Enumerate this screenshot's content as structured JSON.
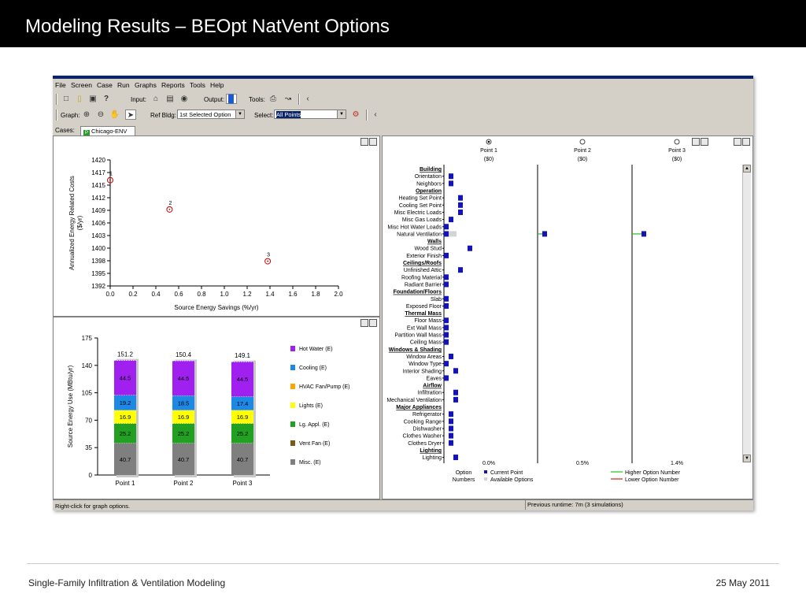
{
  "slide": {
    "title": "Modeling Results – BEOpt NatVent Options",
    "footer_left": "Single-Family Infiltration & Ventilation Modeling",
    "footer_right": "25 May 2011"
  },
  "menu": [
    "File",
    "Screen",
    "Case",
    "Run",
    "Graphs",
    "Reports",
    "Tools",
    "Help"
  ],
  "toolbar1": {
    "input_label": "Input:",
    "output_label": "Output:",
    "tools_label": "Tools:"
  },
  "toolbar2": {
    "graph_label": "Graph:",
    "ref_bldg_label": "Ref Bldg:",
    "ref_bldg_value": "1st Selected Option",
    "select_label": "Select:",
    "select_value": "All Points"
  },
  "cases": {
    "label": "Cases:",
    "tab": "Chicago-ENV"
  },
  "status": {
    "left": "Right-click for graph options.",
    "right": "Previous runtime: 7m (3 simulations)"
  },
  "colors": {
    "accent": "#0a246a",
    "point_marker": "#c00000",
    "option_bar": "#1414b4",
    "available": "#d3d3d3",
    "higher": "#22c022",
    "lower": "#e02020"
  },
  "chart_data": [
    {
      "type": "scatter",
      "xlabel": "Source Energy Savings (%/yr)",
      "ylabel": "Annualized Energy Related Costs ($/yr)",
      "xlim": [
        0,
        2.0
      ],
      "ylim": [
        1392,
        1420
      ],
      "x_ticks": [
        "0.0",
        "0.2",
        "0.4",
        "0.6",
        "0.8",
        "1.0",
        "1.2",
        "1.4",
        "1.6",
        "1.8",
        "2.0"
      ],
      "y_ticks": [
        "1392",
        "1395",
        "1398",
        "1400",
        "1403",
        "1406",
        "1409",
        "1412",
        "1415",
        "1417",
        "1420"
      ],
      "points": [
        {
          "label": "1",
          "x": 0.0,
          "y": 1415.5
        },
        {
          "label": "2",
          "x": 0.52,
          "y": 1409
        },
        {
          "label": "3",
          "x": 1.38,
          "y": 1397.5
        }
      ]
    },
    {
      "type": "bar",
      "stacked": true,
      "ylabel": "Source Energy Use (MBtu/yr)",
      "ylim": [
        0,
        175
      ],
      "y_ticks": [
        "0",
        "35",
        "70",
        "105",
        "140",
        "175"
      ],
      "categories": [
        "Point 1",
        "Point 2",
        "Point 3"
      ],
      "totals": [
        "151.2",
        "150.4",
        "149.1"
      ],
      "series": [
        {
          "name": "Misc. (E)",
          "color": "#7f7f7f",
          "values": [
            40.7,
            40.7,
            40.7
          ]
        },
        {
          "name": "Vent Fan (E)",
          "color": "#7a5a10",
          "values": [
            0,
            0,
            0
          ]
        },
        {
          "name": "Lg. Appl. (E)",
          "color": "#22a022",
          "values": [
            25.2,
            25.2,
            25.2
          ]
        },
        {
          "name": "Lights (E)",
          "color": "#ffff00",
          "values": [
            16.9,
            16.9,
            16.9
          ]
        },
        {
          "name": "HVAC Fan/Pump (E)",
          "color": "#ffa500",
          "values": [
            0,
            0,
            0
          ]
        },
        {
          "name": "Cooling (E)",
          "color": "#1e88e5",
          "values": [
            19.2,
            18.5,
            17.4
          ]
        },
        {
          "name": "Hot Water (E)",
          "color": "#a020f0",
          "values": [
            44.5,
            44.5,
            44.5
          ]
        }
      ],
      "legend_order": [
        "Hot Water (E)",
        "Cooling (E)",
        "HVAC Fan/Pump (E)",
        "Lights (E)",
        "Lg. Appl. (E)",
        "Vent Fan (E)",
        "Misc. (E)"
      ],
      "legend": "right"
    },
    {
      "type": "table",
      "columns": [
        {
          "name": "Point 1",
          "cost": "($0)",
          "selected": true,
          "savings": "0.0%"
        },
        {
          "name": "Point 2",
          "cost": "($0)",
          "selected": false,
          "savings": "0.5%"
        },
        {
          "name": "Point 3",
          "cost": "($0)",
          "selected": false,
          "savings": "1.4%"
        }
      ],
      "rows": [
        {
          "label": "Building",
          "header": true
        },
        {
          "label": "Orientation",
          "opt": [
            1,
            null,
            null
          ]
        },
        {
          "label": "Neighbors",
          "opt": [
            1,
            null,
            null
          ]
        },
        {
          "label": "Operation",
          "header": true
        },
        {
          "label": "Heating Set Point",
          "opt": [
            3,
            null,
            null
          ]
        },
        {
          "label": "Cooling Set Point",
          "opt": [
            3,
            null,
            null
          ]
        },
        {
          "label": "Misc Electric Loads",
          "opt": [
            3,
            null,
            null
          ]
        },
        {
          "label": "Misc Gas Loads",
          "opt": [
            1,
            null,
            null
          ]
        },
        {
          "label": "Misc Hot Water Loads",
          "opt": [
            0,
            null,
            null
          ]
        },
        {
          "label": "Natural Ventilation",
          "opt": [
            0,
            1,
            2
          ],
          "available": true,
          "higher": [
            false,
            true,
            true
          ]
        },
        {
          "label": "Walls",
          "header": true
        },
        {
          "label": "Wood Stud",
          "opt": [
            5,
            null,
            null
          ]
        },
        {
          "label": "Exterior Finish",
          "opt": [
            0,
            null,
            null
          ]
        },
        {
          "label": "Ceilings/Roofs",
          "header": true
        },
        {
          "label": "Unfinished Attic",
          "opt": [
            3,
            null,
            null
          ]
        },
        {
          "label": "Roofing Material",
          "opt": [
            0,
            null,
            null
          ]
        },
        {
          "label": "Radiant Barrier",
          "opt": [
            0,
            null,
            null
          ]
        },
        {
          "label": "Foundation/Floors",
          "header": true
        },
        {
          "label": "Slab",
          "opt": [
            0,
            null,
            null
          ]
        },
        {
          "label": "Exposed Floor",
          "opt": [
            0,
            null,
            null
          ]
        },
        {
          "label": "Thermal Mass",
          "header": true
        },
        {
          "label": "Floor Mass",
          "opt": [
            0,
            null,
            null
          ]
        },
        {
          "label": "Ext Wall Mass",
          "opt": [
            0,
            null,
            null
          ]
        },
        {
          "label": "Partition Wall Mass",
          "opt": [
            0,
            null,
            null
          ]
        },
        {
          "label": "Ceiling Mass",
          "opt": [
            0,
            null,
            null
          ]
        },
        {
          "label": "Windows & Shading",
          "header": true
        },
        {
          "label": "Window Areas",
          "opt": [
            1,
            null,
            null
          ]
        },
        {
          "label": "Window Type",
          "opt": [
            0,
            null,
            null
          ]
        },
        {
          "label": "Interior Shading",
          "opt": [
            2,
            null,
            null
          ]
        },
        {
          "label": "Eaves",
          "opt": [
            0,
            null,
            null
          ]
        },
        {
          "label": "Airflow",
          "header": true
        },
        {
          "label": "Infiltration",
          "opt": [
            2,
            null,
            null
          ]
        },
        {
          "label": "Mechanical Ventilation",
          "display": "Mechanical Ventilation",
          "opt": [
            2,
            null,
            null
          ]
        },
        {
          "label": "Major Appliances",
          "header": true
        },
        {
          "label": "Refrigerator",
          "opt": [
            1,
            null,
            null
          ]
        },
        {
          "label": "Cooking Range",
          "opt": [
            1,
            null,
            null
          ]
        },
        {
          "label": "Dishwasher",
          "opt": [
            1,
            null,
            null
          ]
        },
        {
          "label": "Clothes Washer",
          "opt": [
            1,
            null,
            null
          ]
        },
        {
          "label": "Clothes Dryer",
          "opt": [
            1,
            null,
            null
          ]
        },
        {
          "label": "Lighting",
          "header": true
        },
        {
          "label": "Lighting",
          "opt": [
            2,
            null,
            null
          ]
        }
      ],
      "legend": {
        "option_numbers": "Option Numbers",
        "current": "Current Point",
        "available": "Available Options",
        "higher": "Higher Option Number",
        "lower": "Lower Option Number"
      }
    }
  ]
}
